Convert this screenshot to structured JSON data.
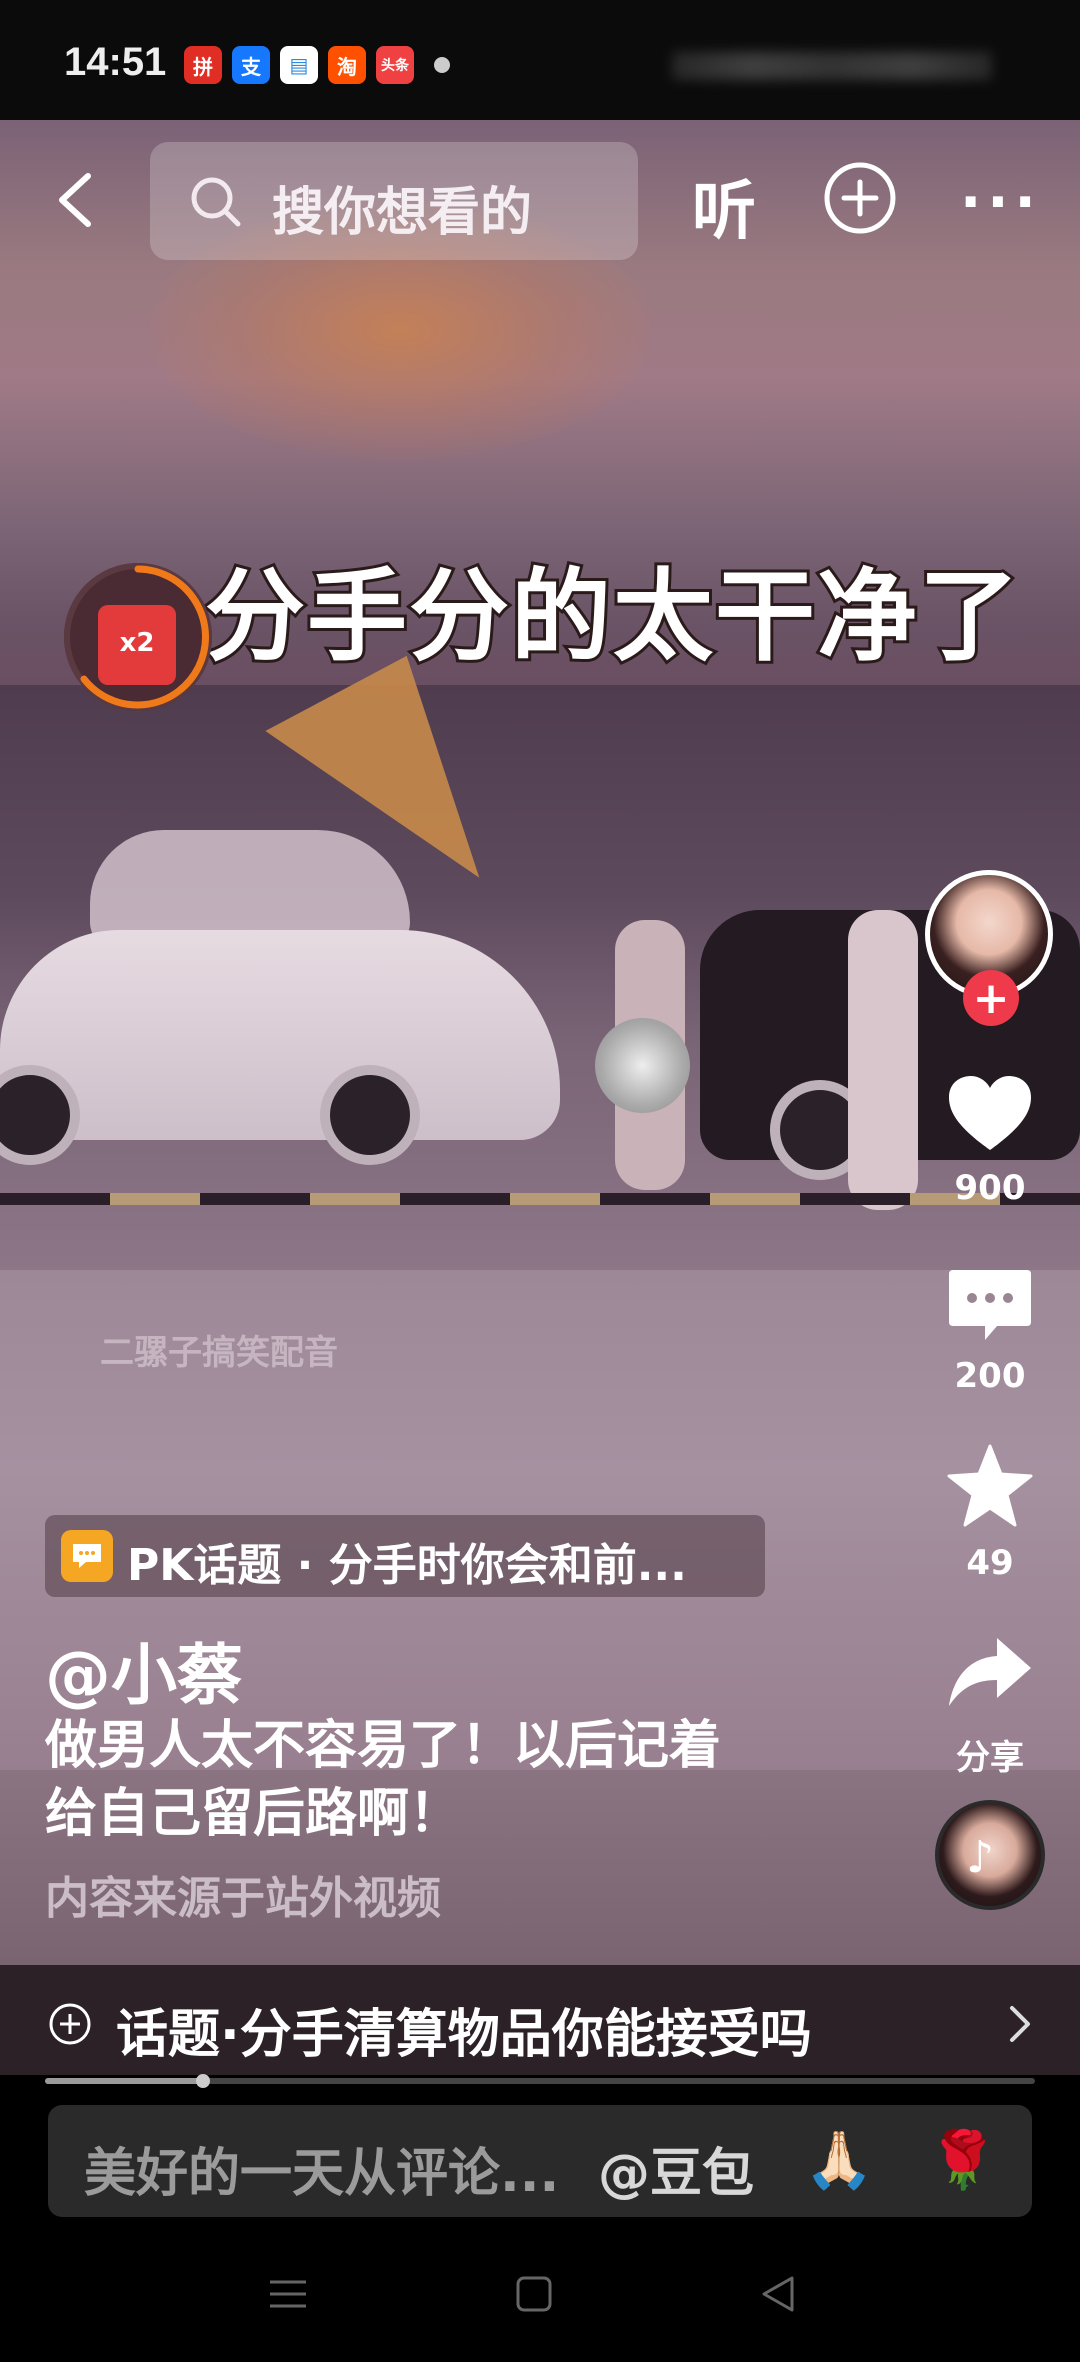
{
  "status_bar": {
    "time": "14:51",
    "app_icons": [
      {
        "name": "pinduoduo-icon",
        "glyph": "拼",
        "bg": "#e02e24"
      },
      {
        "name": "alipay-icon",
        "glyph": "支",
        "bg": "#1677ff"
      },
      {
        "name": "wallet-icon",
        "glyph": "▤",
        "bg": "#ffffff"
      },
      {
        "name": "taobao-icon",
        "glyph": "淘",
        "bg": "#ff5000"
      },
      {
        "name": "toutiao-icon",
        "glyph": "头条",
        "bg": "#f04142"
      }
    ]
  },
  "top_bar": {
    "search_placeholder": "搜你想看的",
    "listen_label": "听"
  },
  "video": {
    "caption": "分手分的太干净了",
    "watermark": "二骡子搞笑配音",
    "red_packet_label": "x2"
  },
  "actions": {
    "likes": "900",
    "comments": "200",
    "favorites": "49",
    "share_label": "分享"
  },
  "post": {
    "pk_topic": "PK话题 · 分手时你会和前...",
    "author": "@小蔡",
    "description_line1": "做男人太不容易了！以后记着",
    "description_line2": "给自己留后路啊！",
    "source_note": "内容来源于站外视频"
  },
  "topic_bar": {
    "label": "话题·分手清算物品你能接受吗"
  },
  "playback": {
    "progress_fraction": 0.16
  },
  "comment_bar": {
    "placeholder": "美好的一天从评论...",
    "mention": "@豆包",
    "emojis": [
      "🙏🏻",
      "🌹"
    ]
  },
  "colors": {
    "accent_red": "#ee3a4a",
    "chip_orange": "#f5a623",
    "ring_orange": "#f07a1a"
  }
}
